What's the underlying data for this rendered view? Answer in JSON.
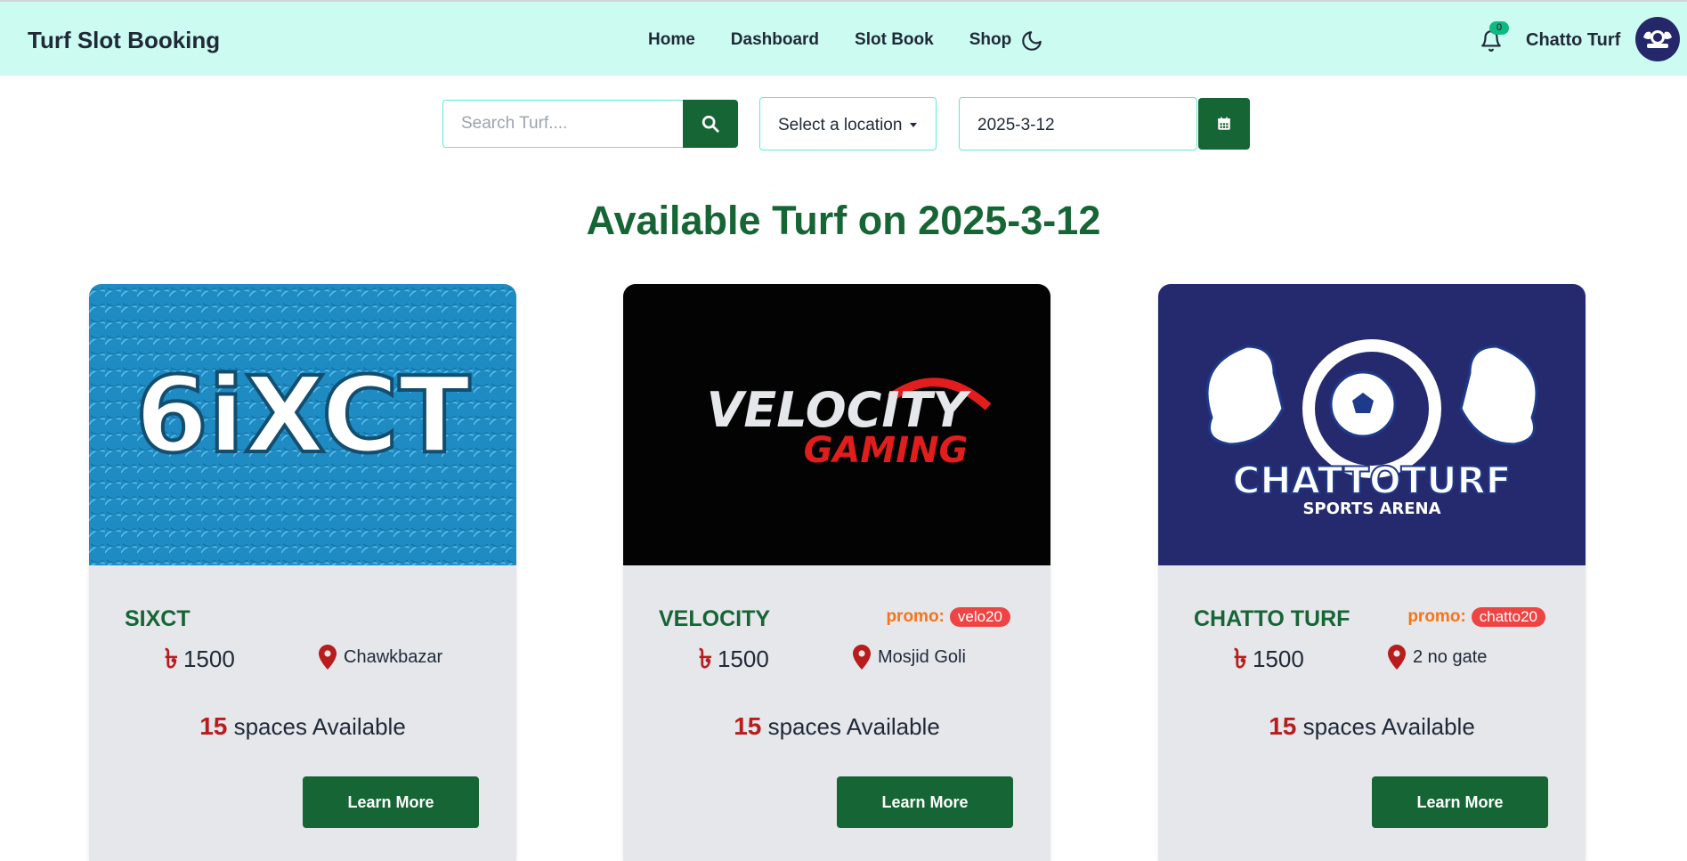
{
  "navbar": {
    "brand": "Turf Slot Booking",
    "links": [
      "Home",
      "Dashboard",
      "Slot Book",
      "Shop"
    ],
    "notification_count": "0",
    "user_name": "Chatto Turf"
  },
  "search": {
    "placeholder": "Search Turf....",
    "location_label": "Select a location",
    "date_value": "2025-3-12"
  },
  "heading": "Available Turf on 2025-3-12",
  "cards": [
    {
      "logo_text": "6iXCT",
      "title": "SIXCT",
      "promo_label": "",
      "promo_code": "",
      "currency": "৳",
      "price": "1500",
      "location": "Chawkbazar",
      "spaces_count": "15",
      "spaces_label": "spaces Available",
      "button": "Learn More"
    },
    {
      "logo_text": "VELOCITY",
      "logo_sub": "GAMING",
      "title": "VELOCITY",
      "promo_label": "promo:",
      "promo_code": "velo20",
      "currency": "৳",
      "price": "1500",
      "location": "Mosjid Goli",
      "spaces_count": "15",
      "spaces_label": "spaces Available",
      "button": "Learn More"
    },
    {
      "logo_text": "CHATTOTURF",
      "logo_sub": "SPORTS ARENA",
      "title": "CHATTO TURF",
      "promo_label": "promo:",
      "promo_code": "chatto20",
      "currency": "৳",
      "price": "1500",
      "location": "2 no gate",
      "spaces_count": "15",
      "spaces_label": "spaces Available",
      "button": "Learn More"
    }
  ],
  "colors": {
    "navbar_bg": "#ccfbf1",
    "primary": "#166534",
    "accent_red": "#b91c1c",
    "promo_orange": "#f97316",
    "promo_badge": "#ef4444",
    "card_bg": "#e5e7eb"
  },
  "icons": [
    "moon-icon",
    "bell-icon",
    "search-icon",
    "calendar-icon",
    "map-pin-icon"
  ]
}
